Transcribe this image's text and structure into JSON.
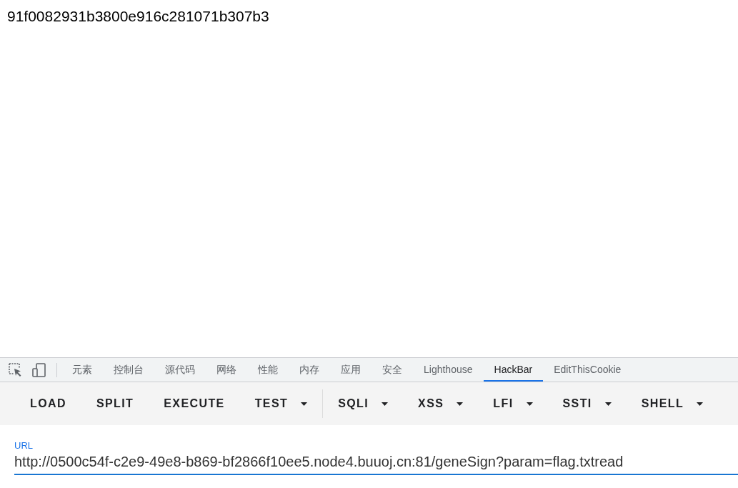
{
  "page": {
    "text": "91f0082931b3800e916c281071b307b3"
  },
  "devtools": {
    "tabs": [
      {
        "label": "元素",
        "selected": false
      },
      {
        "label": "控制台",
        "selected": false
      },
      {
        "label": "源代码",
        "selected": false
      },
      {
        "label": "网络",
        "selected": false
      },
      {
        "label": "性能",
        "selected": false
      },
      {
        "label": "内存",
        "selected": false
      },
      {
        "label": "应用",
        "selected": false
      },
      {
        "label": "安全",
        "selected": false
      },
      {
        "label": "Lighthouse",
        "selected": false
      },
      {
        "label": "HackBar",
        "selected": true
      },
      {
        "label": "EditThisCookie",
        "selected": false
      }
    ]
  },
  "hackbar": {
    "toolbar_groups": [
      [
        {
          "label": "LOAD",
          "kind": "button"
        },
        {
          "label": "SPLIT",
          "kind": "button"
        },
        {
          "label": "EXECUTE",
          "kind": "button"
        },
        {
          "label": "TEST",
          "kind": "dropdown"
        }
      ],
      [
        {
          "label": "SQLI",
          "kind": "dropdown"
        },
        {
          "label": "XSS",
          "kind": "dropdown"
        },
        {
          "label": "LFI",
          "kind": "dropdown"
        },
        {
          "label": "SSTI",
          "kind": "dropdown"
        },
        {
          "label": "SHELL",
          "kind": "dropdown"
        }
      ]
    ],
    "url": {
      "label": "URL",
      "value": "http://0500c54f-c2e9-49e8-b869-bf2866f10ee5.node4.buuoj.cn:81/geneSign?param=flag.txtread"
    }
  }
}
